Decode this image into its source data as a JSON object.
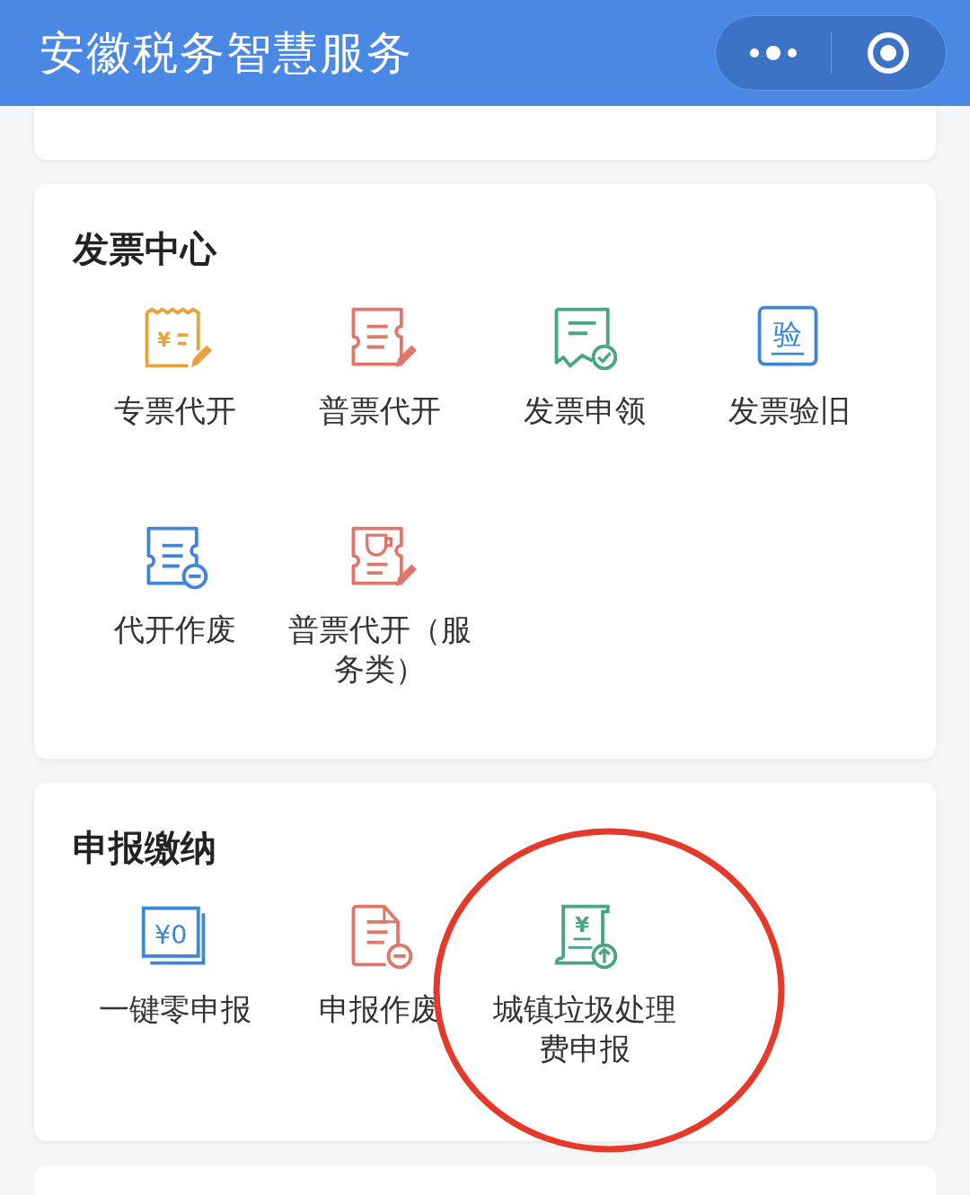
{
  "header": {
    "title": "安徽税务智慧服务"
  },
  "sections": [
    {
      "title": "发票中心",
      "items": [
        {
          "label": "专票代开",
          "kind": "ticket-pen",
          "color": "#e9a23b",
          "icon_text": "¥"
        },
        {
          "label": "普票代开",
          "kind": "lines-pen",
          "color": "#e0756a"
        },
        {
          "label": "发票申领",
          "kind": "receipt-check",
          "color": "#4aa584"
        },
        {
          "label": "发票验旧",
          "kind": "char-box",
          "color": "#3f86d6",
          "icon_text": "验"
        },
        {
          "label": "代开作废",
          "kind": "lines-minus",
          "color": "#3f86d6"
        },
        {
          "label": "普票代开（服务类）",
          "kind": "cup-pen",
          "color": "#e0756a"
        }
      ]
    },
    {
      "title": "申报缴纳",
      "items": [
        {
          "label": "一键零申报",
          "kind": "stack-text",
          "color": "#3f86d6",
          "icon_text": "¥0"
        },
        {
          "label": "申报作废",
          "kind": "doc-minus",
          "color": "#e0756a"
        },
        {
          "label": "城镇垃圾处理费申报",
          "kind": "scroll-up",
          "color": "#4aa584",
          "icon_text": "¥"
        }
      ]
    }
  ]
}
